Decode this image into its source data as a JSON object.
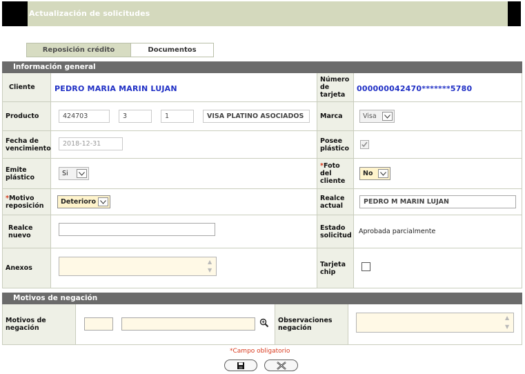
{
  "header": {
    "title": "Actualización de solicitudes"
  },
  "tabs": [
    {
      "label": "Reposición crédito"
    },
    {
      "label": "Documentos"
    }
  ],
  "sections": {
    "general": "Información general",
    "negacion": "Motivos de negación"
  },
  "general": {
    "cliente": {
      "label": "Cliente",
      "value": "PEDRO MARIA MARIN LUJAN"
    },
    "numero_tarjeta": {
      "label": [
        "Número",
        "de",
        "tarjeta"
      ],
      "value": "000000042470*******5780"
    },
    "producto": {
      "label": "Producto",
      "code": "424703",
      "field2": "3",
      "field3": "1",
      "name": "VISA PLATINO ASOCIADOS"
    },
    "marca": {
      "label": "Marca",
      "value": "Visa"
    },
    "fecha_vencimiento": {
      "label": [
        "Fecha de",
        "vencimiento"
      ],
      "value": "2018-12-31"
    },
    "posee_plastico": {
      "label": [
        "Posee",
        "plástico"
      ],
      "checked": true
    },
    "emite_plastico": {
      "label": [
        "Emite",
        "plástico"
      ],
      "value": "Si"
    },
    "foto_cliente": {
      "label": [
        "Foto",
        "del",
        "cliente"
      ],
      "required_mark": "*",
      "value": "No"
    },
    "motivo_reposicion": {
      "label": [
        "Motivo",
        "reposición"
      ],
      "required_mark": "*",
      "value": "Deterioro"
    },
    "realce_actual": {
      "label": [
        "Realce",
        "actual"
      ],
      "value": "PEDRO M MARIN LUJAN"
    },
    "realce_nuevo": {
      "label": [
        "Realce",
        "nuevo"
      ],
      "value": ""
    },
    "estado_solicitud": {
      "label": [
        "Estado",
        "solicitud"
      ],
      "value": "Aprobada parcialmente"
    },
    "anexos": {
      "label": "Anexos",
      "value": ""
    },
    "tarjeta_chip": {
      "label": [
        "Tarjeta",
        "chip"
      ],
      "checked": false
    }
  },
  "negacion": {
    "motivos": {
      "label": [
        "Motivos de",
        "negación"
      ],
      "code": "",
      "description": ""
    },
    "observaciones": {
      "label": [
        "Observaciones",
        "negación"
      ],
      "value": ""
    }
  },
  "footer": {
    "required_mark": "*",
    "required_note": "Campo obligatorio"
  },
  "colors": {
    "header_bg": "#d4d9bd",
    "section_bg": "#6b6b6b",
    "label_bg": "#eef0e6",
    "value_blue": "#1f2fc5",
    "required_red": "#d8391d",
    "input_yellow": "#fff9e6"
  },
  "icons": {
    "save": "save-icon",
    "cancel": "close-icon",
    "search": "magnifier-icon"
  }
}
